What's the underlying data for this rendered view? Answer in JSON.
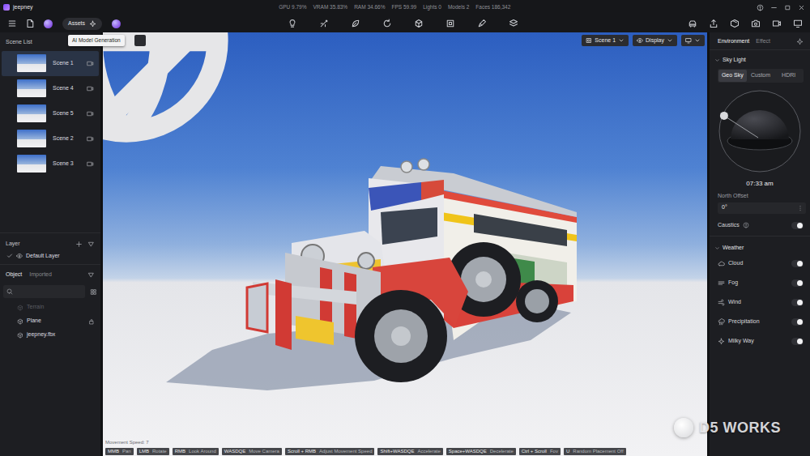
{
  "window": {
    "title": "jeepney",
    "stats": [
      "GPU 9.79%",
      "VRAM 35.83%",
      "RAM 34.66%",
      "FPS 59.99",
      "Lights 0",
      "Models 2",
      "Faces 186,342"
    ]
  },
  "toolbar": {
    "assets": "Assets",
    "tooltip": "AI Model Generation"
  },
  "scene_list": {
    "title": "Scene List",
    "scenes": [
      {
        "name": "Scene 1",
        "selected": true
      },
      {
        "name": "Scene 4",
        "selected": false
      },
      {
        "name": "Scene 5",
        "selected": false
      },
      {
        "name": "Scene 2",
        "selected": false
      },
      {
        "name": "Scene 3",
        "selected": false
      }
    ]
  },
  "layers": {
    "title": "Layer",
    "items": [
      {
        "name": "Default Layer",
        "checked": true
      }
    ]
  },
  "objects": {
    "tabs": [
      {
        "label": "Object",
        "selected": true
      },
      {
        "label": "Imported",
        "selected": false
      }
    ],
    "items": [
      {
        "name": "Terrain",
        "disabled": true,
        "locked": false
      },
      {
        "name": "Plane",
        "disabled": false,
        "locked": true
      },
      {
        "name": "jeepney.fbx",
        "disabled": false,
        "locked": false
      }
    ]
  },
  "viewport": {
    "scene_menu": "Scene 1",
    "display_menu": "Display",
    "movement_speed": "Movement Speed: 7",
    "hints": [
      {
        "key": "MMB",
        "action": "Pan"
      },
      {
        "key": "LMB",
        "action": "Rotate"
      },
      {
        "key": "RMB",
        "action": "Look Around"
      },
      {
        "key": "WASDQE",
        "action": "Move Camera"
      },
      {
        "key": "Scroll + RMB",
        "action": "Adjust Movement Speed"
      },
      {
        "key": "Shift+WASDQE",
        "action": "Accelerate"
      },
      {
        "key": "Space+WASDQE",
        "action": "Decelerate"
      },
      {
        "key": "Ctrl + Scroll",
        "action": "Fov"
      },
      {
        "key": "U",
        "action": "Random Placement Off"
      }
    ],
    "watermark": "D5 WORKS"
  },
  "environment": {
    "tabs": [
      {
        "label": "Environment",
        "selected": true
      },
      {
        "label": "Effect",
        "selected": false
      }
    ],
    "sky_light": {
      "title": "Sky Light",
      "expanded": true,
      "modes": [
        {
          "label": "Geo Sky",
          "selected": true
        },
        {
          "label": "Custom",
          "selected": false
        },
        {
          "label": "HDRI",
          "selected": false
        }
      ],
      "dial_level": 0.13,
      "time": "07:33 am",
      "north_offset_label": "North Offset",
      "north_offset": "0°",
      "caustics": {
        "label": "Caustics",
        "on": false
      }
    },
    "weather": {
      "title": "Weather",
      "expanded": true,
      "items": [
        {
          "name": "Cloud",
          "on": false
        },
        {
          "name": "Fog",
          "on": false
        },
        {
          "name": "Wind",
          "on": false
        },
        {
          "name": "Precipitation",
          "on": false
        },
        {
          "name": "Milky Way",
          "on": false
        }
      ]
    }
  }
}
